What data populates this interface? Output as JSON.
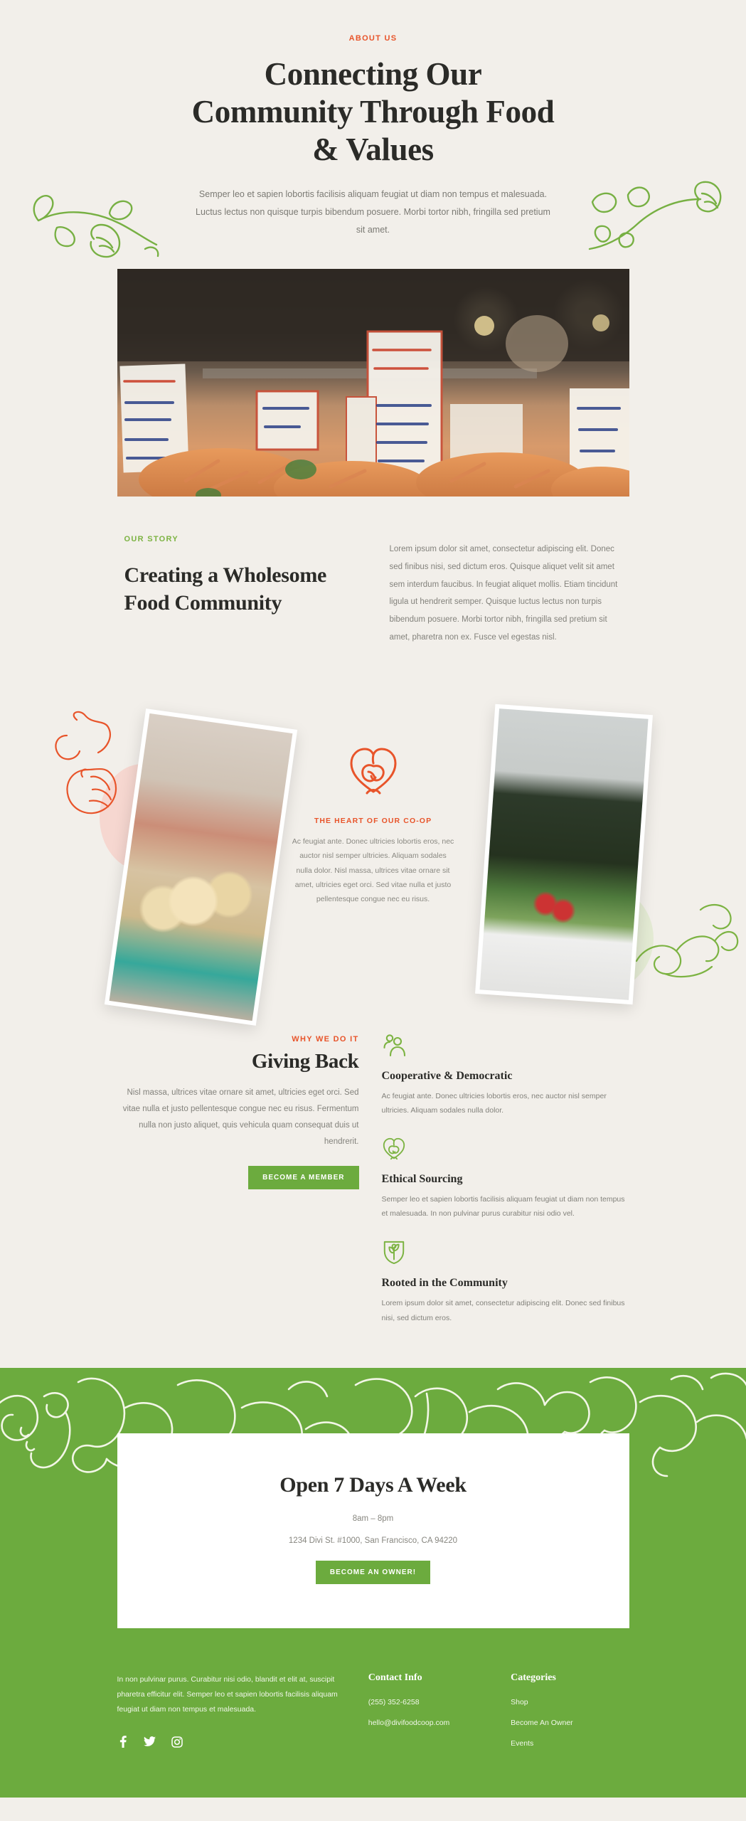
{
  "hero": {
    "eyebrow": "ABOUT US",
    "title": "Connecting Our Community Through Food & Values",
    "paragraph": "Semper leo et sapien lobortis facilisis aliquam feugiat ut diam non tempus et malesuada. Luctus lectus non quisque turpis bibendum posuere. Morbi tortor nibh, fringilla sed pretium sit amet.",
    "image_alt": "crab-market-photo",
    "vine_left_icon": "vine-leaf-doodle-icon",
    "vine_right_icon": "vine-leaf-doodle-icon"
  },
  "story": {
    "eyebrow": "OUR STORY",
    "title": "Creating a Wholesome Food Community",
    "paragraph": "Lorem ipsum dolor sit amet, consectetur adipiscing elit. Donec sed finibus nisi, sed dictum eros. Quisque aliquet velit sit amet sem interdum faucibus. In feugiat aliquet mollis. Etiam tincidunt ligula ut hendrerit semper. Quisque luctus lectus non turpis bibendum posuere. Morbi tortor nibh, fringilla sed pretium sit amet, pharetra non ex. Fusce vel egestas nisl."
  },
  "heart": {
    "icon": "heart-leaf-icon",
    "label": "THE HEART OF OUR CO-OP",
    "paragraph": "Ac feugiat ante. Donec ultricies lobortis eros, nec auctor nisl semper ultricies. Aliquam sodales nulla dolor. Nisl massa, ultrices vitae ornare sit amet, ultricies eget orci. Sed vitae nulla et justo pellentesque congue nec eu risus.",
    "left_image_alt": "farmers-market-produce-photo",
    "right_image_alt": "kale-crate-photo"
  },
  "giving": {
    "eyebrow": "WHY WE DO IT",
    "title": "Giving Back",
    "paragraph": "Nisl massa, ultrices vitae ornare sit amet, ultricies eget orci. Sed vitae nulla et justo pellentesque congue nec eu risus. Fermentum nulla non justo aliquet, quis vehicula quam consequat duis ut hendrerit.",
    "button_label": "BECOME A MEMBER",
    "features": [
      {
        "icon": "people-group-icon",
        "title": "Cooperative & Democratic",
        "text": "Ac feugiat ante. Donec ultricies lobortis eros, nec auctor nisl semper ultricies. Aliquam sodales nulla dolor."
      },
      {
        "icon": "heart-leaf-icon",
        "title": "Ethical Sourcing",
        "text": "Semper leo et sapien lobortis facilisis aliquam feugiat ut diam non tempus et malesuada. In non pulvinar purus curabitur nisi odio vel."
      },
      {
        "icon": "sprout-shield-icon",
        "title": "Rooted in the Community",
        "text": "Lorem ipsum dolor sit amet, consectetur adipiscing elit. Donec sed finibus nisi, sed dictum eros."
      }
    ]
  },
  "cta": {
    "title": "Open 7 Days A Week",
    "hours": "8am – 8pm",
    "address": "1234 Divi St. #1000, San Francisco, CA 94220",
    "button_label": "BECOME AN OWNER!"
  },
  "footer": {
    "about": "In non pulvinar purus. Curabitur nisi odio, blandit et elit at, suscipit pharetra efficitur elit. Semper leo et sapien lobortis facilisis aliquam feugiat ut diam non tempus et malesuada.",
    "socials": [
      {
        "icon": "facebook-icon",
        "glyph": "f"
      },
      {
        "icon": "twitter-icon",
        "glyph": "t"
      },
      {
        "icon": "instagram-icon",
        "glyph": "i"
      }
    ],
    "contact_heading": "Contact Info",
    "contact_items": [
      "(255) 352-6258",
      "hello@divifoodcoop.com"
    ],
    "categories_heading": "Categories",
    "categories_items": [
      "Shop",
      "Become An Owner",
      "Events"
    ]
  },
  "colors": {
    "background": "#f2efea",
    "accent_green": "#6cab3e",
    "accent_orange": "#e8542a",
    "light_green": "#7cb342",
    "text_dark": "#2b2b28",
    "text_muted": "#83827c"
  }
}
